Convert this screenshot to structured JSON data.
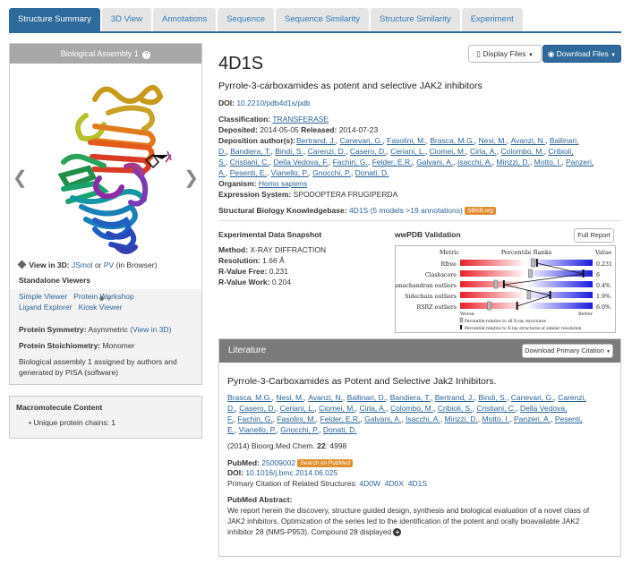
{
  "tabs": [
    "Structure Summary",
    "3D View",
    "Annotations",
    "Sequence",
    "Sequence Similarity",
    "Structure Similarity",
    "Experiment"
  ],
  "left": {
    "assembly_title": "Biological Assembly 1",
    "view3d_label": "View in 3D:",
    "jsmol": "JSmol",
    "or": "or",
    "pv": "PV",
    "in_browser": "(in Browser)",
    "standalone": "Standalone Viewers",
    "viewers": [
      "Simple Viewer",
      "Protein Workshop",
      "Ligand Explorer",
      "Kiosk Viewer"
    ],
    "symmetry_label": "Protein Symmetry:",
    "symmetry_value": "Asymmetric",
    "view_in_3d": "(View in 3D)",
    "stoich_label": "Protein Stoichiometry:",
    "stoich_value": "Monomer",
    "assembly_note_1": "Biological assembly 1 assigned by authors and",
    "assembly_note_2": "generated by PISA (software)"
  },
  "macro": {
    "title": "Macromolecule Content",
    "item": "Unique protein chains: 1"
  },
  "buttons": {
    "display": "Display Files",
    "download": "Download Files",
    "full_report": "Full Report",
    "download_citation": "Download Primary Citation",
    "search_pubmed": "Search on PubMed",
    "sbkb": "SBKB.org"
  },
  "entry": {
    "id": "4D1S",
    "title": "Pyrrole-3-carboxamides as potent and selective JAK2 inhibitors",
    "doi_label": "DOI:",
    "doi": "10.2210/pdb4d1s/pdb",
    "class_label": "Classification:",
    "class": "TRANSFERASE",
    "deposited_label": "Deposited:",
    "deposited": "2014-05-05",
    "released_label": "Released:",
    "released": "2014-07-23",
    "authors_label": "Deposition author(s):",
    "authors_lines": [
      [
        "Bertrand, J.",
        "Canevari, G.",
        "Fasolini, M.",
        "Brasca, M.G.",
        "Nesi, M.",
        "Avanzi, N.",
        "Ballinari,"
      ],
      [
        "D.",
        "Bandiera, T.",
        "Bindi, S.",
        "Carenzi, D.",
        "Casero, D.",
        "Ceriani, L.",
        "Ciomei, M.",
        "Cirla, A.",
        "Colombo, M.",
        "Cribioli,"
      ],
      [
        "S.",
        "Cristiani, C.",
        "Della Vedova, F.",
        "Fachin, G.",
        "Felder, E.R.",
        "Galvani, A.",
        "Isacchi, A.",
        "Mirizzi, D.",
        "Motto, I.",
        "Panzeri,"
      ],
      [
        "A.",
        "Pesenti, E.",
        "Vianello, P.",
        "Gnocchi, P.",
        "Donati, D."
      ]
    ],
    "organism_label": "Organism:",
    "organism": "Homo sapiens",
    "expression_label": "Expression System:",
    "expression": "SPODOPTERA FRUGIPERDA",
    "sbkb_label": "Structural Biology Knowledgebase:",
    "sbkb_id": "4D1S",
    "sbkb_text": "(5 models >19 annotations)"
  },
  "snapshot": {
    "title": "Experimental Data Snapshot",
    "method_label": "Method:",
    "method": "X-RAY DIFFRACTION",
    "resolution_label": "Resolution:",
    "resolution": "1.66 Å",
    "rfree_label": "R-Value Free:",
    "rfree": "0.231",
    "rwork_label": "R-Value Work:",
    "rwork": "0.204"
  },
  "validation": {
    "title": "wwPDB Validation",
    "header_metric": "Metric",
    "header_ranks": "Percentile Ranks",
    "header_value": "Value",
    "rows": [
      {
        "metric": "Rfree",
        "value": "0.231",
        "pct": 0.55,
        "pct2": 0.58
      },
      {
        "metric": "Clashscore",
        "value": "6",
        "pct": 0.53,
        "pct2": 0.93
      },
      {
        "metric": "Ramachandran outliers",
        "value": "0.4%",
        "pct": 0.27,
        "pct2": 0.33
      },
      {
        "metric": "Sidechain outliers",
        "value": "1.9%",
        "pct": 0.52,
        "pct2": 0.68
      },
      {
        "metric": "RSRZ outliers",
        "value": "6.0%",
        "pct": 0.22,
        "pct2": 0.43
      }
    ],
    "worse": "Worse",
    "better": "Better",
    "legend1": "Percentile relative to all X-ray structures",
    "legend2": "Percentile relative to X-ray structures of similar resolution"
  },
  "literature": {
    "header": "Literature",
    "title": "Pyrrole-3-Carboxamides as Potent and Selective Jak2 Inhibitors.",
    "authors_lines": [
      [
        "Brasca, M.G.",
        "Nesi, M.",
        "Avanzi, N.",
        "Ballinari, D.",
        "Bandiera, T.",
        "Bertrand, J.",
        "Bindi, S.",
        "Canevari, G.",
        "Carenzi,"
      ],
      [
        "D.",
        "Casero, D.",
        "Ceriani, L.",
        "Ciomei, M.",
        "Cirla, A.",
        "Colombo, M.",
        "Cribioli, S.",
        "Cristiani, C.",
        "Della Vedova,"
      ],
      [
        "F.",
        "Fachin, G.",
        "Fasolini, M.",
        "Felder, E.R.",
        "Galvani, A.",
        "Isacchi, A.",
        "Mirizzi, D.",
        "Motto, I.",
        "Panzeri, A.",
        "Pesenti,"
      ],
      [
        "E.",
        "Vianello, P.",
        "Gnocchi, P.",
        "Donati, D."
      ]
    ],
    "journal_pre": "(2014) Bioorg.Med.Chem.",
    "volume": "22",
    "pages": ": 4998",
    "pubmed_label": "PubMed:",
    "pubmed": "25009002",
    "doi_label": "DOI:",
    "doi": "10.1016/j.bmc.2014.06.025",
    "primary_label": "Primary Citation of Related Structures:",
    "related": [
      "4D0W",
      "4D0X",
      "4D1S"
    ],
    "abstract_label": "PubMed Abstract:",
    "abstract_lines": [
      "We report herein the discovery, structure guided design, synthesis and biological evaluation of a novel class of",
      "JAK2 inhibitors. Optimization of the series led to the identification of the potent and orally bioavailable JAK2",
      "inhibitor 28 (NMS-P953). Compound 28 displayed"
    ]
  }
}
